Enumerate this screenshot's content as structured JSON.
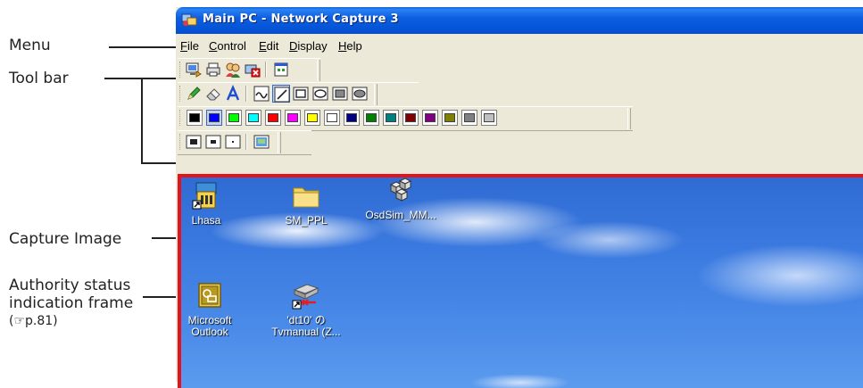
{
  "callouts": {
    "menu": "Menu",
    "toolbar": "Tool bar",
    "capture_image": "Capture Image",
    "authority_line1": "Authority status",
    "authority_line2": "indication frame",
    "authority_line3": "(☞p.81)"
  },
  "window": {
    "title": "Main PC - Network Capture 3"
  },
  "menu": [
    {
      "label": "File",
      "accel": "F",
      "rest": "ile"
    },
    {
      "label": "Control",
      "accel": "C",
      "rest": "ontrol"
    },
    {
      "label": "Edit",
      "accel": "E",
      "rest": "dit"
    },
    {
      "label": "Display",
      "accel": "D",
      "rest": "isplay"
    },
    {
      "label": "Help",
      "accel": "H",
      "rest": "elp"
    }
  ],
  "toolbar_icons": {
    "row1": [
      "capture-icon",
      "print-icon",
      "users-icon",
      "disconnect-icon",
      "window-icon"
    ],
    "row2": [
      "pen-icon",
      "eraser-icon",
      "text-icon",
      "freehand-icon",
      "line-icon",
      "rectangle-icon",
      "ellipse-icon",
      "filled-rectangle-icon",
      "filled-ellipse-icon"
    ],
    "row4": [
      "line-thick-icon",
      "line-medium-icon",
      "line-thin-icon",
      "screen-icon"
    ]
  },
  "palette": [
    "#000000",
    "#0000ff",
    "#00ff00",
    "#00ffff",
    "#ff0000",
    "#ff00ff",
    "#ffff00",
    "#ffffff",
    "#000080",
    "#008000",
    "#008080",
    "#800000",
    "#800080",
    "#808000",
    "#808080",
    "#c0c0c0"
  ],
  "palette_selected_index": 1,
  "desktop_icons": [
    {
      "line1": "Lhasa",
      "line2": ""
    },
    {
      "line1": "SM_PPL",
      "line2": ""
    },
    {
      "line1": "OsdSim_MM...",
      "line2": ""
    },
    {
      "line1": "Microsoft",
      "line2": "Outlook"
    },
    {
      "line1": "'dt10' の",
      "line2": "Tvmanual (Z..."
    }
  ],
  "colors": {
    "authority_frame": "#e3121b",
    "titlebar": "#0453d6"
  }
}
